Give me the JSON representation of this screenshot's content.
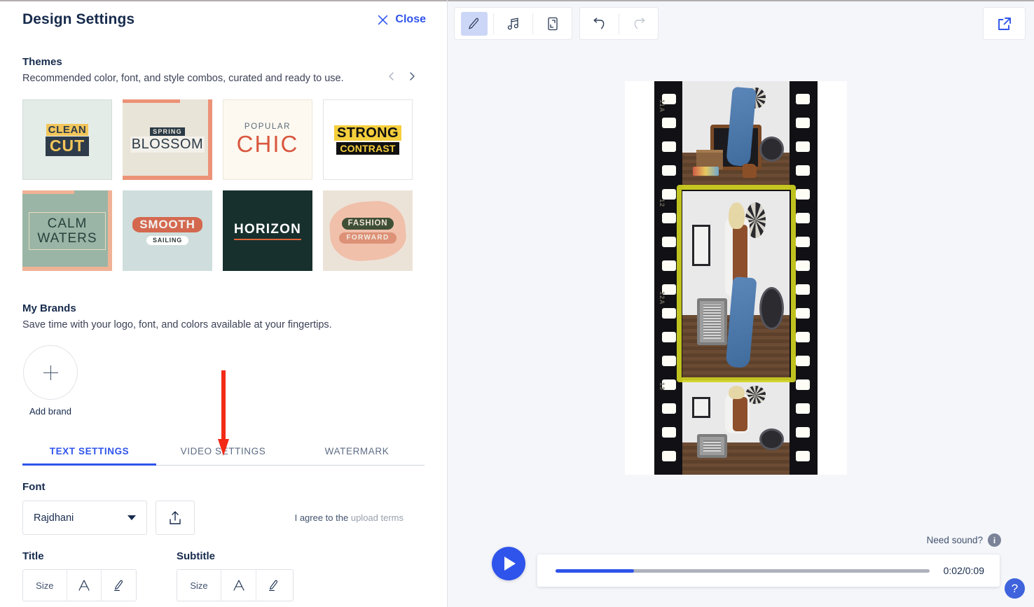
{
  "panel": {
    "title": "Design Settings",
    "close_label": "Close",
    "themes": {
      "title": "Themes",
      "description": "Recommended color, font, and style combos, curated and ready to use.",
      "prev_icon": "chevron-left-icon",
      "next_icon": "chevron-right-icon",
      "cards": [
        {
          "name": "clean-cut",
          "line1": "CLEAN",
          "line2": "CUT"
        },
        {
          "name": "spring-blossom",
          "line1": "SPRING",
          "line2": "BLOSSOM"
        },
        {
          "name": "popular-chic",
          "line1": "POPULAR",
          "line2": "CHIC"
        },
        {
          "name": "strong-contrast",
          "line1": "STRONG",
          "line2": "CONTRAST"
        },
        {
          "name": "calm-waters",
          "line1": "CALM",
          "line2": "WATERS"
        },
        {
          "name": "smooth-sailing",
          "line1": "SMOOTH",
          "line2": "SAILING"
        },
        {
          "name": "horizon",
          "line1": "HORIZON",
          "line2": ""
        },
        {
          "name": "fashion-forward",
          "line1": "FASHION",
          "line2": "FORWARD"
        }
      ]
    },
    "brands": {
      "title": "My Brands",
      "description": "Save time with your logo, font, and colors available at your fingertips.",
      "add_label": "Add brand",
      "add_icon": "plus-icon"
    },
    "tabs": [
      {
        "label": "TEXT SETTINGS",
        "active": true
      },
      {
        "label": "VIDEO SETTINGS",
        "active": false
      },
      {
        "label": "WATERMARK",
        "active": false
      }
    ],
    "font": {
      "label": "Font",
      "selected": "Rajdhani",
      "upload_icon": "upload-icon",
      "agree_text": "I agree to the",
      "terms_link": "upload terms"
    },
    "title_field": {
      "label": "Title",
      "size_label": "Size",
      "font_icon": "letter-a-icon",
      "color_icon": "highlighter-icon"
    },
    "subtitle_field": {
      "label": "Subtitle",
      "size_label": "Size",
      "font_icon": "letter-a-icon",
      "color_icon": "highlighter-icon"
    },
    "annotation": {
      "name": "red-down-arrow",
      "color": "#f22a16"
    }
  },
  "stage": {
    "toolbar": {
      "tools": [
        {
          "name": "edit-pencil-tool",
          "active": true
        },
        {
          "name": "music-note-tool",
          "active": false
        },
        {
          "name": "resize-crop-tool",
          "active": false
        }
      ],
      "history": [
        {
          "name": "undo-button",
          "disabled": false
        },
        {
          "name": "redo-button",
          "disabled": true
        }
      ],
      "export_icon": "external-link-icon"
    },
    "preview": {
      "name": "video-preview",
      "film_codes": [
        "11A",
        "12",
        "12A",
        "13"
      ]
    },
    "playback": {
      "play_icon": "play-icon",
      "time_display": "0:02/0:09",
      "progress_percent": 21,
      "need_sound_label": "Need sound?",
      "info_icon": "info-icon",
      "help_icon": "help-icon",
      "help_glyph": "?"
    }
  },
  "colors": {
    "accent_blue": "#2f54eb",
    "panel_bg": "#ffffff",
    "stage_bg": "#f5f6fa",
    "annotation_red": "#f22a16",
    "highlight_yellow": "#cfd121"
  }
}
